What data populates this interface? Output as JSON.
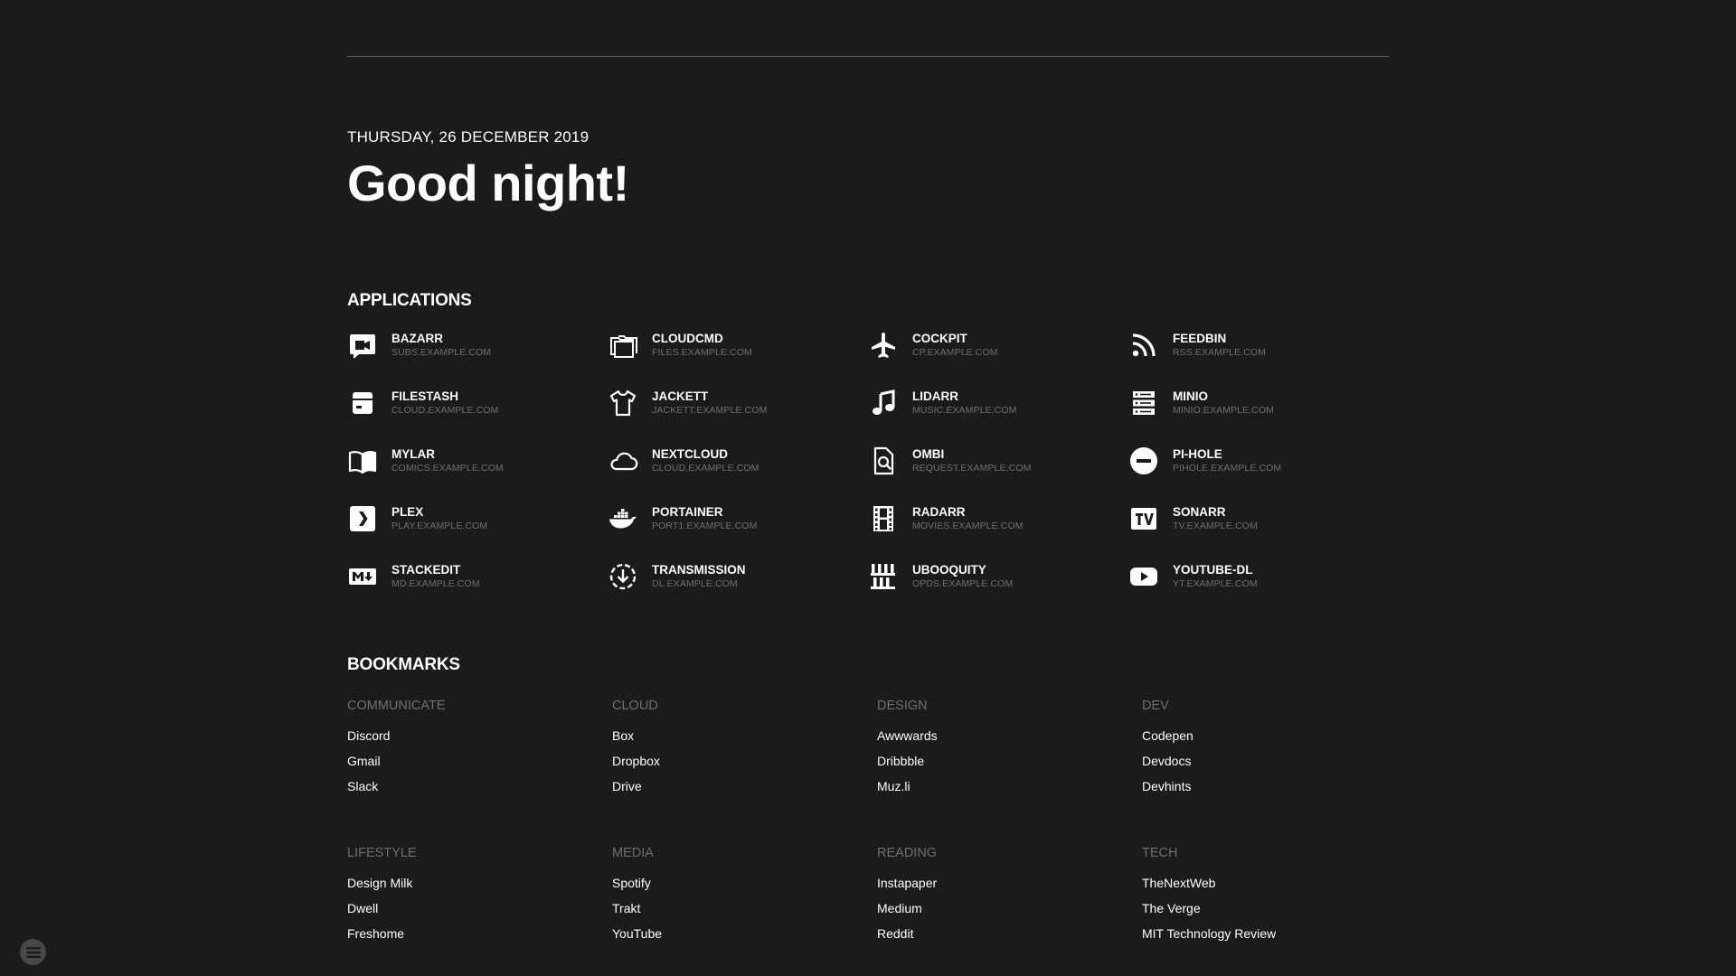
{
  "header": {
    "date": "THURSDAY, 26 DECEMBER 2019",
    "greeting": "Good night!"
  },
  "applications": {
    "title": "APPLICATIONS",
    "items": [
      {
        "name": "BAZARR",
        "url": "SUBS.EXAMPLE.COM",
        "icon": "subtitles-icon"
      },
      {
        "name": "CLOUDCMD",
        "url": "FILES.EXAMPLE.COM",
        "icon": "folders-icon"
      },
      {
        "name": "COCKPIT",
        "url": "CP.EXAMPLE.COM",
        "icon": "airplane-icon"
      },
      {
        "name": "FEEDBIN",
        "url": "RSS.EXAMPLE.COM",
        "icon": "rss-icon"
      },
      {
        "name": "FILESTASH",
        "url": "CLOUD.EXAMPLE.COM",
        "icon": "archive-icon"
      },
      {
        "name": "JACKETT",
        "url": "JACKETT.EXAMPLE.COM",
        "icon": "tshirt-icon"
      },
      {
        "name": "LIDARR",
        "url": "MUSIC.EXAMPLE.COM",
        "icon": "music-note-icon"
      },
      {
        "name": "MINIO",
        "url": "MINIO.EXAMPLE.COM",
        "icon": "server-icon"
      },
      {
        "name": "MYLAR",
        "url": "COMICS.EXAMPLE.COM",
        "icon": "book-open-icon"
      },
      {
        "name": "NEXTCLOUD",
        "url": "CLOUD.EXAMPLE.COM",
        "icon": "cloud-icon"
      },
      {
        "name": "OMBI",
        "url": "REQUEST.EXAMPLE.COM",
        "icon": "file-search-icon"
      },
      {
        "name": "PI-HOLE",
        "url": "PIHOLE.EXAMPLE.COM",
        "icon": "minus-circle-icon"
      },
      {
        "name": "PLEX",
        "url": "PLAY.EXAMPLE.COM",
        "icon": "plex-icon"
      },
      {
        "name": "PORTAINER",
        "url": "PORT1.EXAMPLE.COM",
        "icon": "docker-icon"
      },
      {
        "name": "RADARR",
        "url": "MOVIES.EXAMPLE.COM",
        "icon": "film-icon"
      },
      {
        "name": "SONARR",
        "url": "TV.EXAMPLE.COM",
        "icon": "tv-icon"
      },
      {
        "name": "STACKEDIT",
        "url": "MD.EXAMPLE.COM",
        "icon": "markdown-icon"
      },
      {
        "name": "TRANSMISSION",
        "url": "DL.EXAMPLE.COM",
        "icon": "download-circle-icon"
      },
      {
        "name": "UBOOQUITY",
        "url": "OPDS.EXAMPLE.COM",
        "icon": "bookshelf-icon"
      },
      {
        "name": "YOUTUBE-DL",
        "url": "YT.EXAMPLE.COM",
        "icon": "youtube-icon"
      }
    ]
  },
  "bookmarks": {
    "title": "BOOKMARKS",
    "categories": [
      {
        "name": "COMMUNICATE",
        "links": [
          "Discord",
          "Gmail",
          "Slack"
        ]
      },
      {
        "name": "CLOUD",
        "links": [
          "Box",
          "Dropbox",
          "Drive"
        ]
      },
      {
        "name": "DESIGN",
        "links": [
          "Awwwards",
          "Dribbble",
          "Muz.li"
        ]
      },
      {
        "name": "DEV",
        "links": [
          "Codepen",
          "Devdocs",
          "Devhints"
        ]
      },
      {
        "name": "LIFESTYLE",
        "links": [
          "Design Milk",
          "Dwell",
          "Freshome"
        ]
      },
      {
        "name": "MEDIA",
        "links": [
          "Spotify",
          "Trakt",
          "YouTube"
        ]
      },
      {
        "name": "READING",
        "links": [
          "Instapaper",
          "Medium",
          "Reddit"
        ]
      },
      {
        "name": "TECH",
        "links": [
          "TheNextWeb",
          "The Verge",
          "MIT Technology Review"
        ]
      }
    ]
  },
  "menu": {
    "icon": "menu-icon"
  },
  "colors": {
    "background": "#1b1b1b",
    "primary": "#fefefe",
    "secondary": "#6f6f6f",
    "divider": "#5a5a5a"
  }
}
